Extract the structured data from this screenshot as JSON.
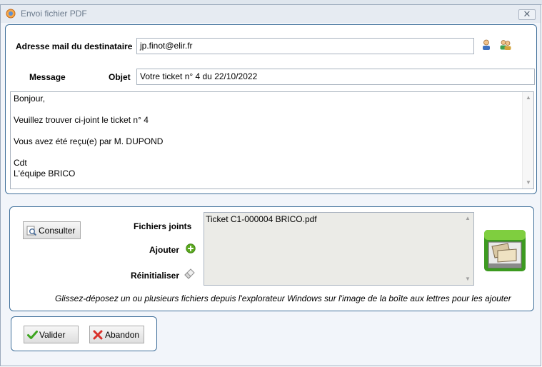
{
  "window": {
    "title": "Envoi fichier PDF",
    "close_label": "✕"
  },
  "recipient": {
    "label": "Adresse mail du destinataire",
    "value": "jp.finot@elir.fr"
  },
  "message": {
    "label": "Message",
    "subject_label": "Objet",
    "subject_value": "Votre ticket n° 4 du 22/10/2022",
    "body_lines": [
      "Bonjour,",
      "Veuillez trouver ci-joint le ticket n° 4",
      "Vous avez été reçu(e) par M.  DUPOND",
      "Cdt",
      "L'équipe BRICO"
    ]
  },
  "attachments": {
    "consult_label": "Consulter",
    "files_label": "Fichiers joints",
    "add_label": "Ajouter",
    "reset_label": "Réinitialiser",
    "files": [
      "Ticket C1-000004 BRICO.pdf"
    ],
    "hint": "Glissez-déposez un ou plusieurs fichiers depuis l'explorateur Windows sur l'image de la boîte aux lettres pour les ajouter"
  },
  "actions": {
    "validate_label": "Valider",
    "cancel_label": "Abandon"
  },
  "icons": [
    "app-icon",
    "close-icon",
    "contact-icon",
    "contacts-group-icon",
    "consult-icon",
    "add-icon",
    "eraser-icon",
    "mailbox-icon",
    "checkmark-icon",
    "cross-icon"
  ],
  "colors": {
    "panel_border": "#3f6f9a",
    "add_green": "#5aa81e",
    "check_green": "#3da51f",
    "cancel_red": "#d9302a"
  }
}
